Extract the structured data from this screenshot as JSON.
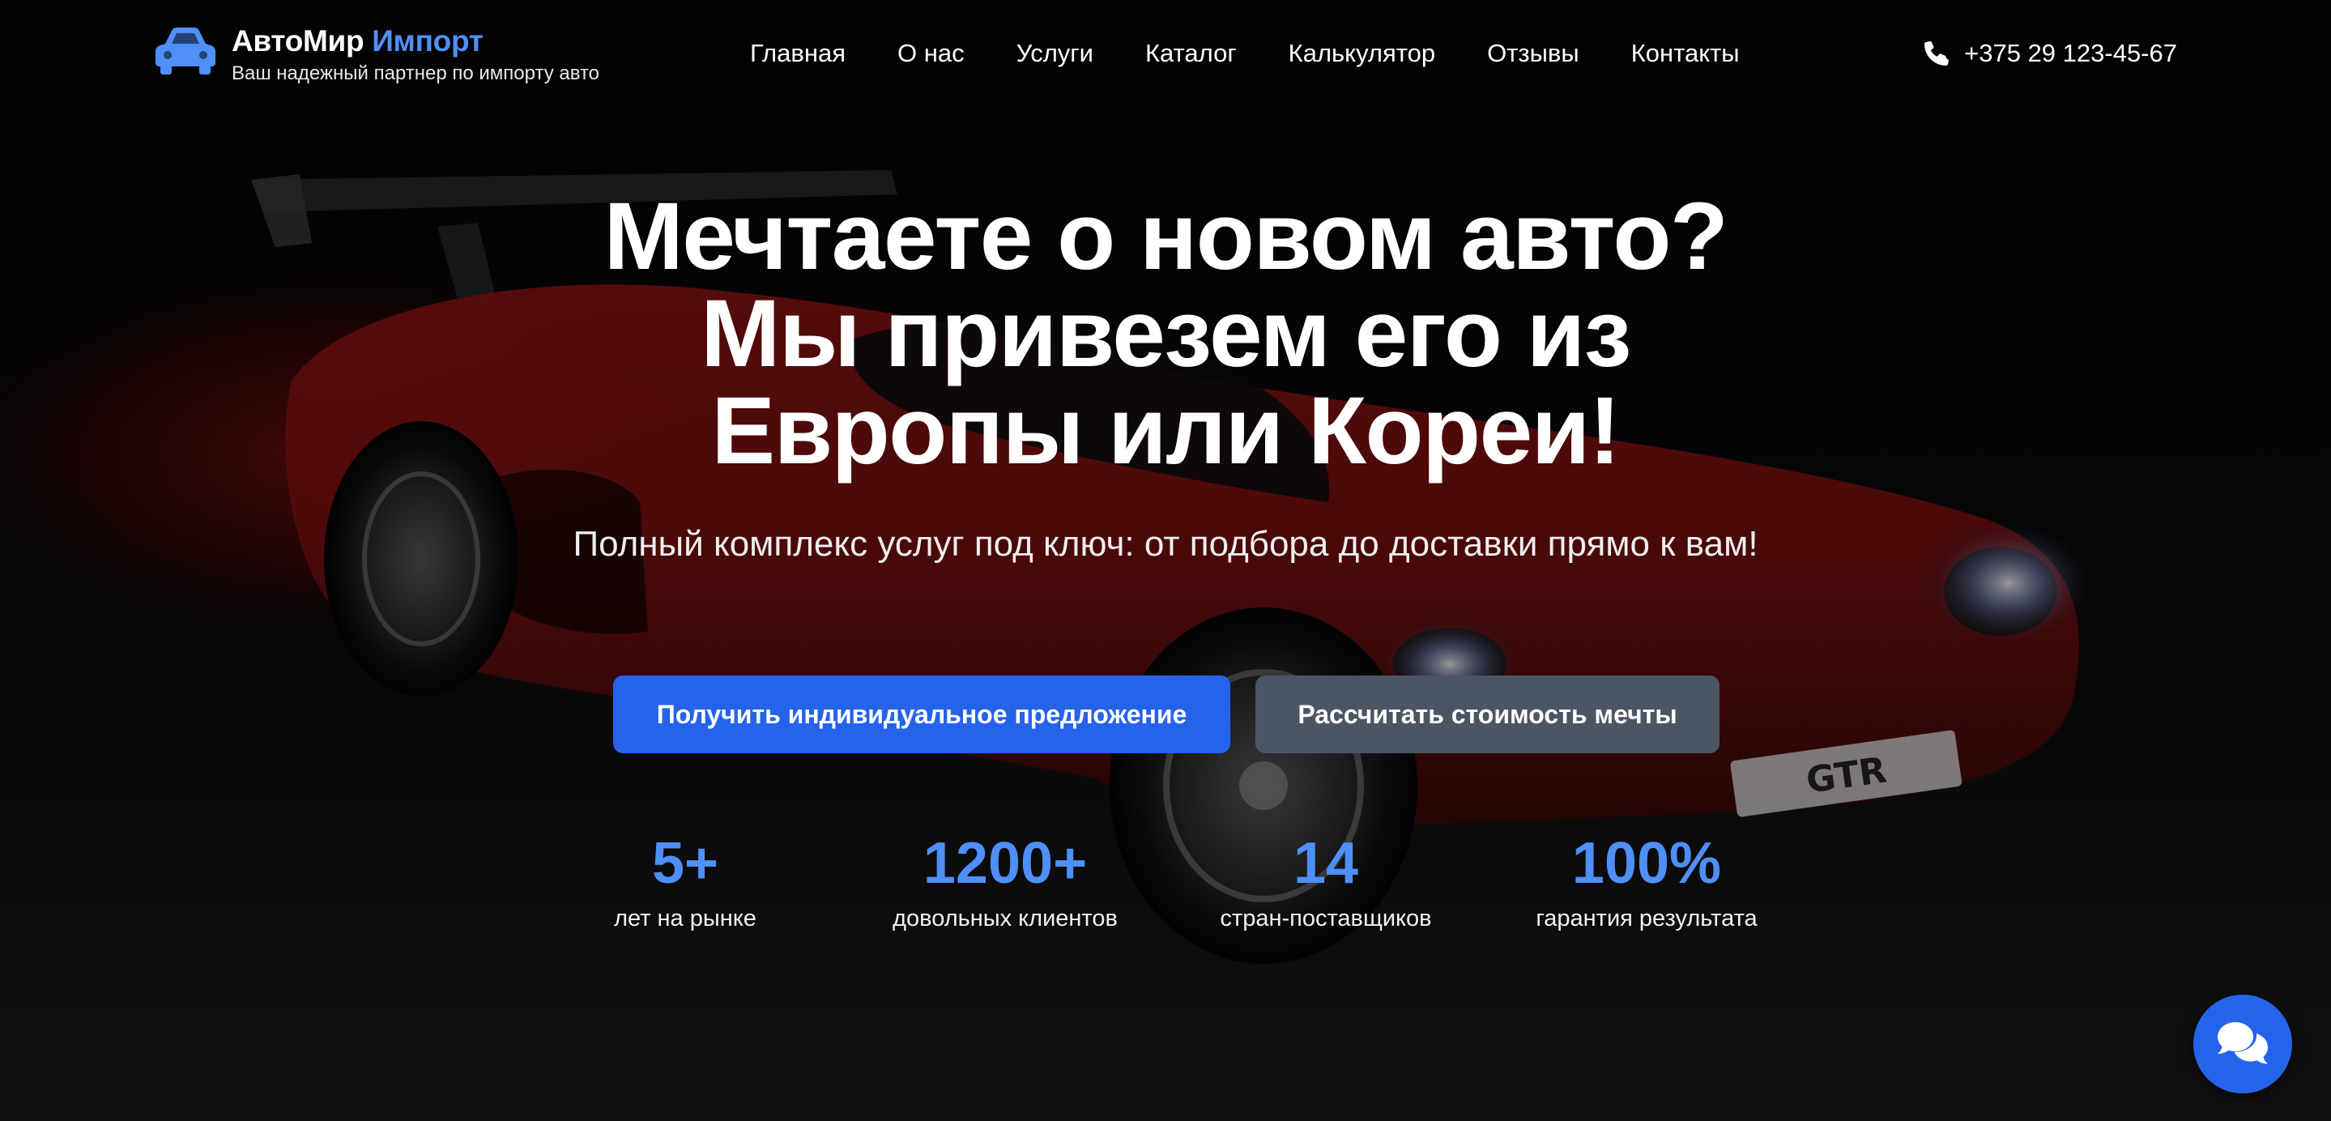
{
  "brand": {
    "name": "АвтоМир",
    "name_accent": "Импорт",
    "tagline": "Ваш надежный партнер по импорту авто",
    "icon": "car-icon"
  },
  "nav": {
    "items": [
      {
        "label": "Главная"
      },
      {
        "label": "О нас"
      },
      {
        "label": "Услуги"
      },
      {
        "label": "Каталог"
      },
      {
        "label": "Калькулятор"
      },
      {
        "label": "Отзывы"
      },
      {
        "label": "Контакты"
      }
    ]
  },
  "phone": {
    "icon": "phone-icon",
    "number": "+375 29 123-45-67"
  },
  "hero": {
    "title_line1": "Мечтаете о новом авто?",
    "title_line2": "Мы привезем его из",
    "title_line3": "Европы или Кореи!",
    "subtitle": "Полный комплекс услуг под ключ: от подбора до доставки прямо к вам!",
    "primary_button": "Получить индивидуальное предложение",
    "secondary_button": "Рассчитать стоимость мечты",
    "plate_text": "GTR"
  },
  "stats": [
    {
      "value": "5+",
      "label": "лет на рынке"
    },
    {
      "value": "1200+",
      "label": "довольных клиентов"
    },
    {
      "value": "14",
      "label": "стран-поставщиков"
    },
    {
      "value": "100%",
      "label": "гарантия результата"
    }
  ],
  "chat": {
    "icon": "chat-icon"
  },
  "colors": {
    "accent": "#4f8ff7",
    "primary_button": "#2563eb",
    "secondary_button": "#4b5563",
    "background": "#050505",
    "car": "#b01818"
  }
}
